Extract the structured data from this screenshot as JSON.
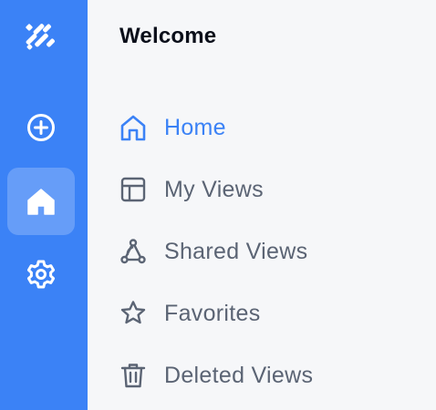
{
  "colors": {
    "rail": "#3b82f6",
    "panel": "#f6f7f9",
    "accent": "#3b82f6",
    "text": "#5b6474"
  },
  "rail": {
    "logo_icon": "brand-logo",
    "items": [
      {
        "name": "add",
        "icon": "plus-circle-icon",
        "active": false
      },
      {
        "name": "home",
        "icon": "home-icon",
        "active": true
      },
      {
        "name": "settings",
        "icon": "gear-icon",
        "active": false
      }
    ]
  },
  "panel": {
    "title": "Welcome",
    "nav": [
      {
        "label": "Home",
        "icon": "home-outline-icon",
        "active": true
      },
      {
        "label": "My Views",
        "icon": "layout-icon",
        "active": false
      },
      {
        "label": "Shared Views",
        "icon": "share-nodes-icon",
        "active": false
      },
      {
        "label": "Favorites",
        "icon": "star-icon",
        "active": false
      },
      {
        "label": "Deleted Views",
        "icon": "trash-icon",
        "active": false
      }
    ]
  }
}
